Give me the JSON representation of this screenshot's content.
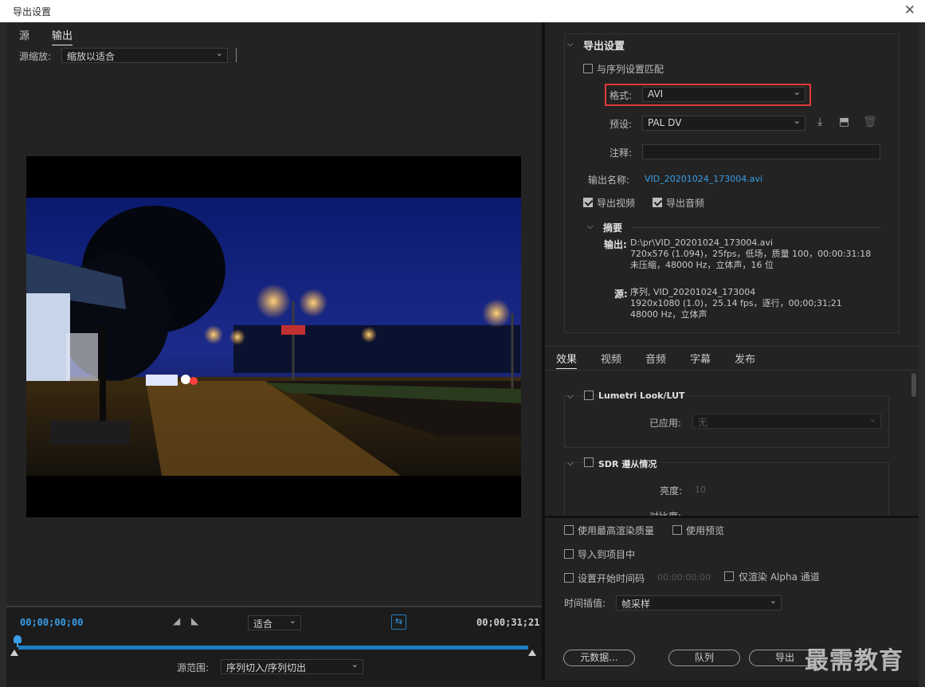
{
  "window": {
    "title": "导出设置"
  },
  "left": {
    "tabs": [
      "源",
      "输出"
    ],
    "source_scale_label": "源缩放:",
    "source_scale_value": "缩放以适合"
  },
  "timeline": {
    "tc_start": "00;00;00;00",
    "tc_end": "00;00;31;21",
    "fit_value": "适合",
    "source_range_label": "源范围:",
    "source_range_value": "序列切入/序列切出"
  },
  "export": {
    "header": "导出设置",
    "match_sequence": "与序列设置匹配",
    "format_label": "格式:",
    "format_value": "AVI",
    "preset_label": "预设:",
    "preset_value": "PAL DV",
    "comment_label": "注释:",
    "output_name_label": "输出名称:",
    "output_name_value": "VID_20201024_173004.avi",
    "export_video": "导出视频",
    "export_audio": "导出音频",
    "summary": {
      "header": "摘要",
      "output_label": "输出:",
      "output_lines": [
        "D:\\pr\\VID_20201024_173004.avi",
        "720x576 (1.094)，25fps，低场，质量 100，00:00:31:18",
        "未压缩，48000 Hz，立体声，16 位"
      ],
      "source_label": "源:",
      "source_lines": [
        "序列, VID_20201024_173004",
        "1920x1080 (1.0)，25.14 fps，逐行，00;00;31;21",
        "48000 Hz，立体声"
      ]
    }
  },
  "effects_tabs": [
    "效果",
    "视频",
    "音频",
    "字幕",
    "发布"
  ],
  "effects": {
    "lumetri_header": "Lumetri Look/LUT",
    "applied_label": "已应用:",
    "applied_value": "无",
    "sdr_header": "SDR 遵从情况",
    "brightness_label": "亮度:",
    "brightness_value": "10",
    "contrast_label": "对比度:"
  },
  "bottom": {
    "max_render": "使用最高渲染质量",
    "use_preview": "使用预览",
    "import_project": "导入到项目中",
    "set_start_tc": "设置开始时间码",
    "start_tc_value": "00:00:00:00",
    "alpha_only": "仅渲染 Alpha 通道",
    "interp_label": "时间插值:",
    "interp_value": "帧采样"
  },
  "buttons": {
    "metadata": "元数据...",
    "queue": "队列",
    "export": "导出"
  },
  "watermark": "最需教育",
  "colors": {
    "accent": "#1f7dc4",
    "highlight_red": "#e03a3a",
    "link": "#3a9ee8"
  }
}
